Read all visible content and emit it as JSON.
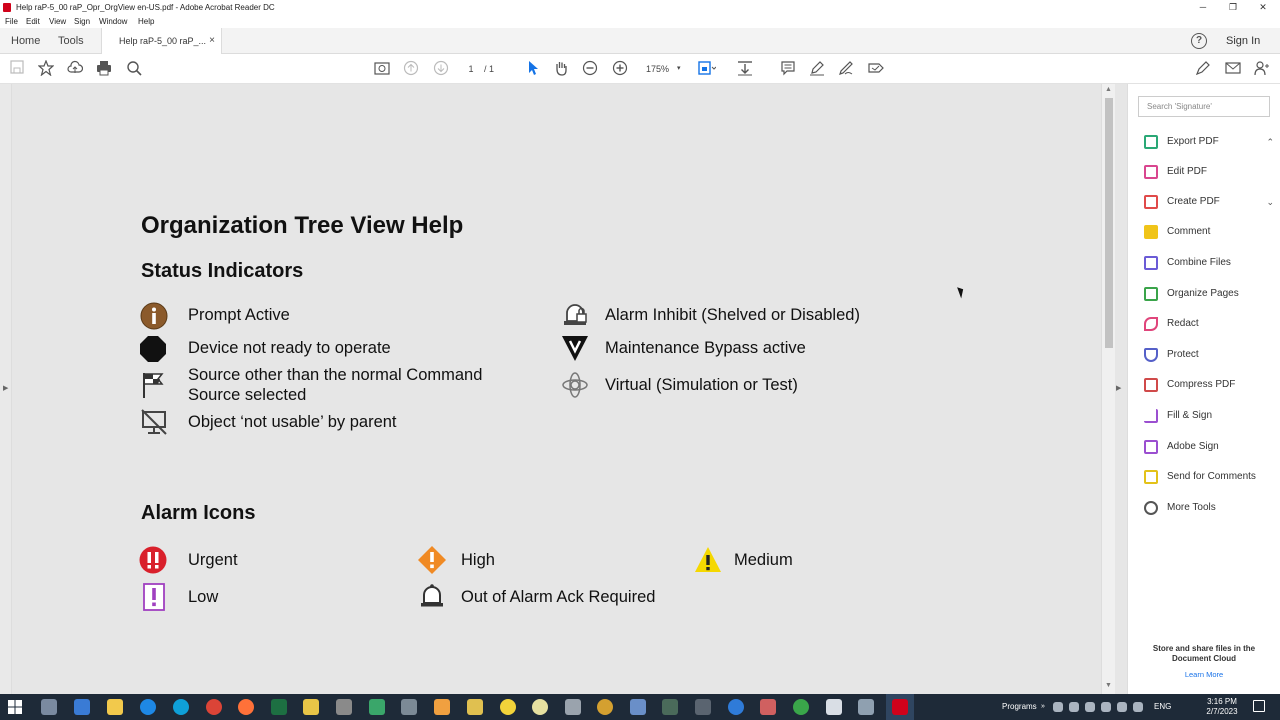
{
  "window": {
    "title": "Help raP-5_00 raP_Opr_OrgView en-US.pdf - Adobe Acrobat Reader DC",
    "minimize": "─",
    "restore": "❐",
    "close": "✕"
  },
  "menu": [
    "File",
    "Edit",
    "View",
    "Sign",
    "Window",
    "Help"
  ],
  "tabs": {
    "home": "Home",
    "tools": "Tools",
    "doc": "Help raP-5_00 raP_...",
    "close": "×",
    "help": "?",
    "signin": "Sign In"
  },
  "toolbar": {
    "page_current": "1",
    "page_total": "/ 1",
    "zoom": "175%"
  },
  "document": {
    "title": "Organization Tree View Help",
    "status_heading": "Status Indicators",
    "status_left": [
      {
        "icon": "info-circle-icon",
        "label": "Prompt Active"
      },
      {
        "icon": "octagon-icon",
        "label": "Device not ready to operate"
      },
      {
        "icon": "flag-icon",
        "label": "Source other than the normal Command Source selected"
      },
      {
        "icon": "crossed-monitor-icon",
        "label": "Object ‘not usable’ by parent"
      }
    ],
    "status_right": [
      {
        "icon": "alarm-inhibit-icon",
        "label": "Alarm Inhibit (Shelved or Disabled)"
      },
      {
        "icon": "maintenance-bypass-icon",
        "label": "Maintenance Bypass active"
      },
      {
        "icon": "virtual-icon",
        "label": "Virtual (Simulation or Test)"
      }
    ],
    "alarm_heading": "Alarm Icons",
    "alarms": [
      {
        "icon": "urgent-icon",
        "label": "Urgent",
        "color": "#d9202b"
      },
      {
        "icon": "high-icon",
        "label": "High",
        "color": "#f08a24"
      },
      {
        "icon": "medium-icon",
        "label": "Medium",
        "color": "#f5d800"
      },
      {
        "icon": "low-icon",
        "label": "Low",
        "color": "#a040c0"
      },
      {
        "icon": "bell-icon",
        "label": "Out of Alarm Ack Required",
        "color": "#333333"
      }
    ]
  },
  "rightpane": {
    "search_placeholder": "Search 'Signature'",
    "tools": [
      {
        "label": "Export PDF",
        "color": "#2aa876",
        "chev": "⌃"
      },
      {
        "label": "Edit PDF",
        "color": "#d9468f",
        "chev": ""
      },
      {
        "label": "Create PDF",
        "color": "#e04a4a",
        "chev": "⌄"
      },
      {
        "label": "Comment",
        "color": "#f0c419",
        "chev": ""
      },
      {
        "label": "Combine Files",
        "color": "#6b5bd6",
        "chev": ""
      },
      {
        "label": "Organize Pages",
        "color": "#3aa44a",
        "chev": ""
      },
      {
        "label": "Redact",
        "color": "#e0457b",
        "chev": ""
      },
      {
        "label": "Protect",
        "color": "#5560c8",
        "chev": ""
      },
      {
        "label": "Compress PDF",
        "color": "#d04a4a",
        "chev": ""
      },
      {
        "label": "Fill & Sign",
        "color": "#9b4fd0",
        "chev": ""
      },
      {
        "label": "Adobe Sign",
        "color": "#9b4fd0",
        "chev": ""
      },
      {
        "label": "Send for Comments",
        "color": "#e3c21a",
        "chev": ""
      },
      {
        "label": "More Tools",
        "color": "#555555",
        "chev": ""
      }
    ],
    "cloud_text": "Store and share files in the Document Cloud",
    "learn_more": "Learn More"
  },
  "taskbar": {
    "programs": "Programs",
    "lang": "ENG",
    "time": "3:16 PM",
    "date": "2/7/2023"
  }
}
